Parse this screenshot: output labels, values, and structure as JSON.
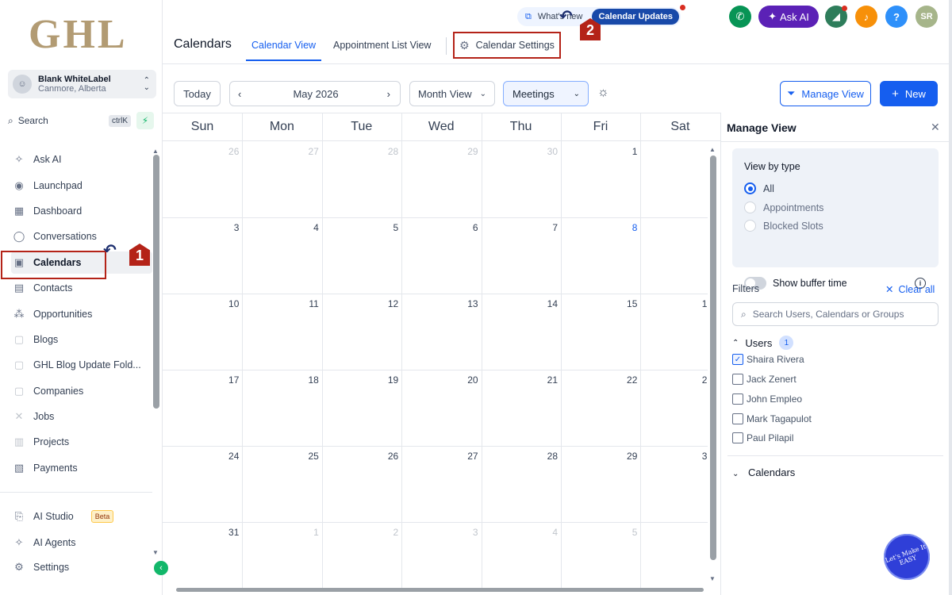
{
  "sidebar": {
    "logo": "GHL",
    "account": {
      "initials": "☺",
      "name": "Blank WhiteLabel",
      "location": "Canmore, Alberta"
    },
    "search": {
      "label": "Search",
      "shortcut": "ctrlK"
    },
    "items": [
      {
        "label": "Ask AI",
        "icon": "sparkle-icon"
      },
      {
        "label": "Launchpad",
        "icon": "rocket-icon"
      },
      {
        "label": "Dashboard",
        "icon": "grid-icon"
      },
      {
        "label": "Conversations",
        "icon": "chat-icon"
      },
      {
        "label": "Calendars",
        "icon": "calendar-icon"
      },
      {
        "label": "Contacts",
        "icon": "contacts-icon"
      },
      {
        "label": "Opportunities",
        "icon": "pipeline-icon"
      },
      {
        "label": "Blogs",
        "icon": "box-icon"
      },
      {
        "label": "GHL Blog Update Fold...",
        "icon": "box-icon"
      },
      {
        "label": "Companies",
        "icon": "box-icon"
      },
      {
        "label": "Jobs",
        "icon": "tools-icon"
      },
      {
        "label": "Projects",
        "icon": "folder-icon"
      },
      {
        "label": "Payments",
        "icon": "receipt-icon"
      }
    ],
    "bottom_items": [
      {
        "label": "AI Studio",
        "badge": "Beta"
      },
      {
        "label": "AI Agents"
      },
      {
        "label": "Settings"
      }
    ]
  },
  "annotations": {
    "step1": "1",
    "step2": "2"
  },
  "header": {
    "whats_new": "What's new",
    "updates_pill": "Calendar Updates",
    "ask_ai": "Ask AI",
    "avatar": "SR",
    "help": "?"
  },
  "page": {
    "title": "Calendars",
    "tabs": [
      "Calendar View",
      "Appointment List View",
      "Calendar Settings"
    ]
  },
  "toolbar": {
    "today": "Today",
    "month": "May 2026",
    "view": "Month View",
    "filter": "Meetings",
    "manage_view": "Manage View",
    "new": "New"
  },
  "calendar": {
    "weekdays": [
      "Sun",
      "Mon",
      "Tue",
      "Wed",
      "Thu",
      "Fri",
      "Sat"
    ],
    "weeks": [
      [
        "26",
        "27",
        "28",
        "29",
        "30",
        "1",
        ""
      ],
      [
        "3",
        "4",
        "5",
        "6",
        "7",
        "8",
        ""
      ],
      [
        "10",
        "11",
        "12",
        "13",
        "14",
        "15",
        "1"
      ],
      [
        "17",
        "18",
        "19",
        "20",
        "21",
        "22",
        "2"
      ],
      [
        "24",
        "25",
        "26",
        "27",
        "28",
        "29",
        "3"
      ],
      [
        "31",
        "1",
        "2",
        "3",
        "4",
        "5",
        ""
      ]
    ],
    "muted": [
      [
        0,
        0
      ],
      [
        0,
        1
      ],
      [
        0,
        2
      ],
      [
        0,
        3
      ],
      [
        0,
        4
      ],
      [
        5,
        1
      ],
      [
        5,
        2
      ],
      [
        5,
        3
      ],
      [
        5,
        4
      ],
      [
        5,
        5
      ]
    ],
    "today": [
      1,
      5
    ]
  },
  "manage_view": {
    "title": "Manage View",
    "view_by_type": "View by type",
    "types": [
      "All",
      "Appointments",
      "Blocked Slots"
    ],
    "show_buffer": "Show buffer time",
    "filters": "Filters",
    "clear_all": "Clear all",
    "search_placeholder": "Search Users, Calendars or Groups",
    "users_label": "Users",
    "users_count": "1",
    "users": [
      {
        "name": "Shaira Rivera",
        "checked": true
      },
      {
        "name": "Jack Zenert",
        "checked": false
      },
      {
        "name": "John Empleo",
        "checked": false
      },
      {
        "name": "Mark Tagapulot",
        "checked": false
      },
      {
        "name": "Paul Pilapil",
        "checked": false
      }
    ],
    "calendars_label": "Calendars"
  },
  "watermark": "Let's Make It EASY"
}
